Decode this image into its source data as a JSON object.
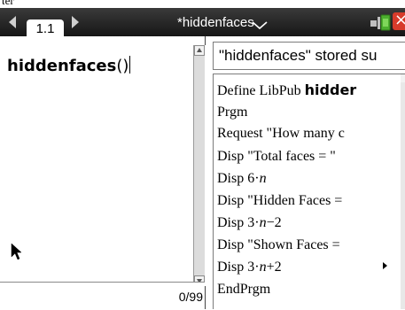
{
  "top_crop": {
    "text": "ter"
  },
  "titlebar": {
    "tab_label": "1.1",
    "document_title": "*hiddenfaces"
  },
  "calculator": {
    "entry_function": "hiddenfaces",
    "entry_args": "()",
    "counter": "0/99"
  },
  "result": {
    "status_text": "\"hiddenfaces\" stored su"
  },
  "program_listing": {
    "line1_prefix": "Define LibPub ",
    "line1_name": "hidder",
    "line2": "Prgm",
    "line3": "Request \"How many c",
    "line4": "Disp \"Total faces = \"",
    "line5_prefix": "Disp 6·",
    "line5_var": "n",
    "line6": "Disp \"Hidden Faces =",
    "line7_prefix": "Disp 3·",
    "line7_var": "n",
    "line7_suffix": "−2",
    "line8": "Disp \"Shown Faces =",
    "line9_prefix": "Disp 3·",
    "line9_var": "n",
    "line9_suffix": "+2",
    "line10": "EndPrgm"
  },
  "colors": {
    "titlebar_bg": "#1c1c1c",
    "close_red": "#d73b2b",
    "battery_green": "#4caf2e"
  }
}
